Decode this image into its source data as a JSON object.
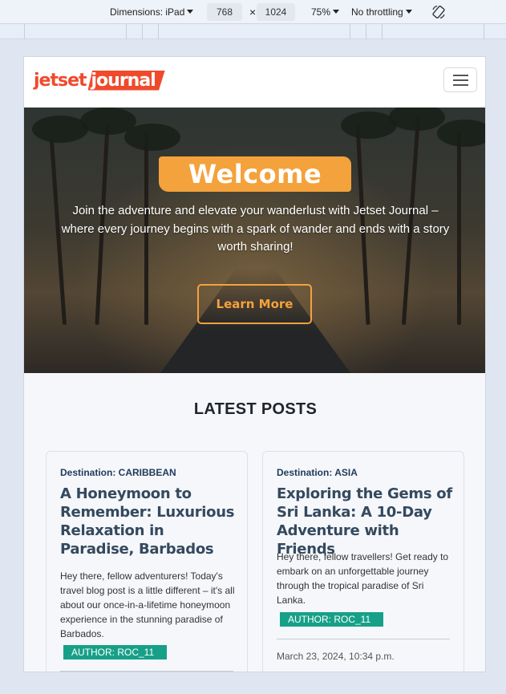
{
  "devtools": {
    "dimensions_label": "Dimensions: iPad",
    "width": "768",
    "times": "×",
    "height": "1024",
    "zoom": "75%",
    "throttling": "No throttling",
    "rotate_icon": "rotate-icon"
  },
  "navbar": {
    "logo_part1": "jetset",
    "logo_part2": "journal",
    "menu_icon": "hamburger-icon"
  },
  "hero": {
    "heading": "Welcome",
    "text": "Join the adventure and elevate your wanderlust with Jetset Journal – where every journey begins with a spark of wander and ends with a story worth sharing!",
    "button": "Learn More"
  },
  "section_title": "LATEST POSTS",
  "posts": [
    {
      "destination": "Destination: CARIBBEAN",
      "title": "A Honeymoon to Remember: Luxurious Relaxation in Paradise, Barbados",
      "excerpt": "Hey there, fellow adventurers! Today's travel blog post is a little different – it's all about our once-in-a-lifetime honeymoon experience in the stunning paradise of Barbados.",
      "author": "AUTHOR: ROC_11"
    },
    {
      "destination": "Destination: ASIA",
      "title": "Exploring the Gems of Sri Lanka: A 10-Day Adventure with Friends",
      "excerpt": "Hey there, fellow travellers! Get ready to embark on an unforgettable journey through the tropical paradise of Sri Lanka.",
      "author": "AUTHOR: ROC_11",
      "date": "March 23, 2024, 10:34 p.m."
    }
  ],
  "colors": {
    "accent": "#f4a23c",
    "logo": "#f04a2c",
    "author_badge": "#17a088"
  }
}
